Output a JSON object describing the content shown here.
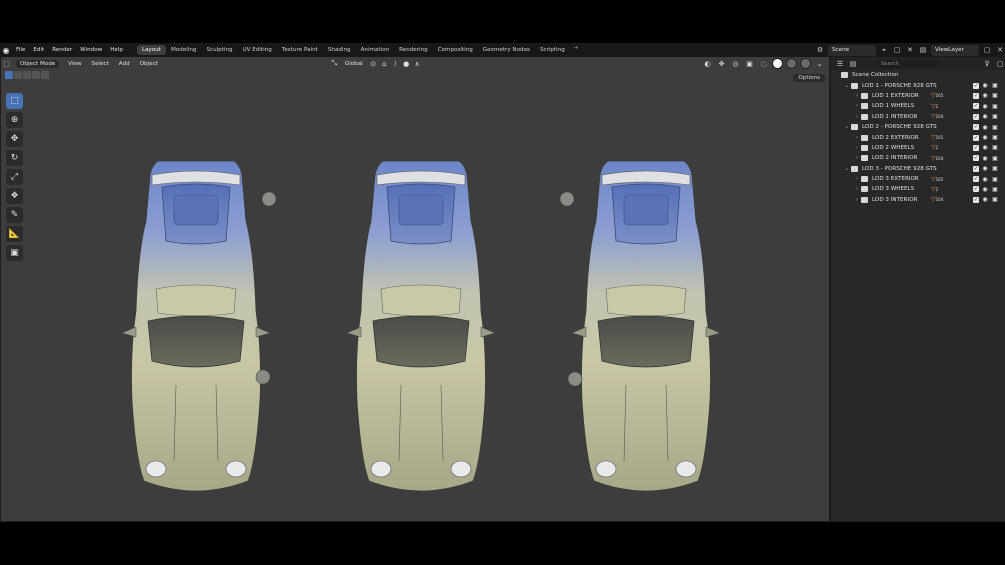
{
  "menu": [
    "File",
    "Edit",
    "Render",
    "Window",
    "Help"
  ],
  "workspaces": [
    {
      "label": "Layout",
      "active": true
    },
    {
      "label": "Modeling"
    },
    {
      "label": "Sculpting"
    },
    {
      "label": "UV Editing"
    },
    {
      "label": "Texture Paint"
    },
    {
      "label": "Shading"
    },
    {
      "label": "Animation"
    },
    {
      "label": "Rendering"
    },
    {
      "label": "Compositing"
    },
    {
      "label": "Geometry Nodes"
    },
    {
      "label": "Scripting"
    }
  ],
  "scene": {
    "name": "Scene",
    "view_layer": "ViewLayer"
  },
  "viewport": {
    "mode": "Object Mode",
    "header_menu": [
      "View",
      "Select",
      "Add",
      "Object"
    ],
    "transform_orientation": "Global",
    "options_label": "Options"
  },
  "outliner": {
    "search_placeholder": "Search",
    "root": "Scene Collection",
    "rows": [
      {
        "label": "LOD 1 - PORSCHE 928 GTS",
        "level": 0
      },
      {
        "label": "LOD 1 EXTERIOR",
        "level": 1,
        "badge": "165"
      },
      {
        "label": "LOD 1 WHEELS",
        "level": 1,
        "badge": "2"
      },
      {
        "label": "LOD 1 INTERIOR",
        "level": 1,
        "badge": "104"
      },
      {
        "label": "LOD 2 - PORSCHE 928 GTS",
        "level": 0
      },
      {
        "label": "LOD 2 EXTERIOR",
        "level": 1,
        "badge": "165"
      },
      {
        "label": "LOD 2 WHEELS",
        "level": 1,
        "badge": "2"
      },
      {
        "label": "LOD 2 INTERIOR",
        "level": 1,
        "badge": "104"
      },
      {
        "label": "LOD 3 - PORSCHE 928 GTS",
        "level": 0
      },
      {
        "label": "LOD 3 EXTERIOR",
        "level": 1,
        "badge": "165"
      },
      {
        "label": "LOD 3 WHEELS",
        "level": 1,
        "badge": "2"
      },
      {
        "label": "LOD 3 INTERIOR",
        "level": 1,
        "badge": "104"
      }
    ]
  },
  "colors": {
    "accent": "#4772b3",
    "viewport_bg": "#3d3d3d",
    "badge": "#e08a3a"
  }
}
